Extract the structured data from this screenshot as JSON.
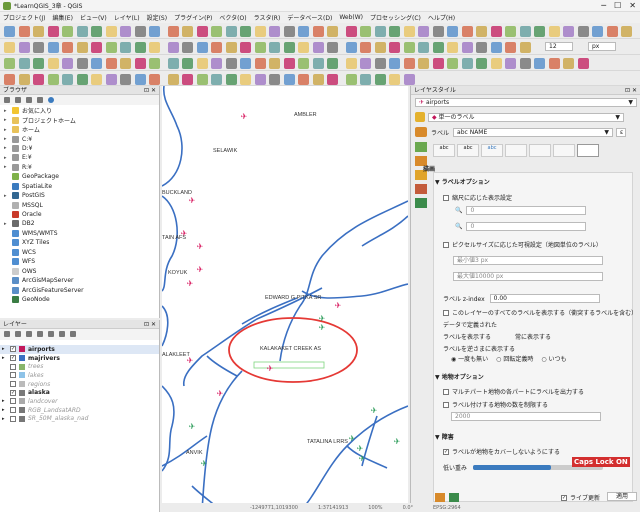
{
  "window": {
    "title": "*LearnQGIS_3章 - QGIS"
  },
  "menu": [
    "プロジェクト(J)",
    "編集(E)",
    "ビュー(V)",
    "レイヤ(L)",
    "設定(S)",
    "プラグイン(P)",
    "ベクタ(O)",
    "ラスタ(R)",
    "データベース(D)",
    "Web(W)",
    "プロセッシング(C)",
    "ヘルプ(H)"
  ],
  "toolbar": {
    "font_size": "12",
    "unit": "px",
    "text_label": "T"
  },
  "browser": {
    "title": "ブラウザ",
    "items": [
      {
        "label": "お気に入り",
        "icon": "star-icon",
        "color": "#f2c531"
      },
      {
        "label": "プロジェクトホーム",
        "icon": "folder-icon",
        "color": "#e8c25a"
      },
      {
        "label": "ホーム",
        "icon": "folder-icon",
        "color": "#e8c25a"
      },
      {
        "label": "C:¥",
        "icon": "drive-icon",
        "color": "#999999"
      },
      {
        "label": "D:¥",
        "icon": "drive-icon",
        "color": "#999999"
      },
      {
        "label": "E:¥",
        "icon": "drive-icon",
        "color": "#999999"
      },
      {
        "label": "R:¥",
        "icon": "drive-icon",
        "color": "#999999"
      },
      {
        "label": "GeoPackage",
        "icon": "geopackage-icon",
        "color": "#7fb24a"
      },
      {
        "label": "SpatiaLite",
        "icon": "spatialite-icon",
        "color": "#3b7bbf"
      },
      {
        "label": "PostGIS",
        "icon": "postgis-icon",
        "color": "#336791"
      },
      {
        "label": "MSSQL",
        "icon": "mssql-icon",
        "color": "#b0b0b0"
      },
      {
        "label": "Oracle",
        "icon": "oracle-icon",
        "color": "#c93b2b"
      },
      {
        "label": "DB2",
        "icon": "db2-icon",
        "color": "#6a6a6a"
      },
      {
        "label": "WMS/WMTS",
        "icon": "wms-icon",
        "color": "#4f8ed1"
      },
      {
        "label": "XYZ Tiles",
        "icon": "xyz-icon",
        "color": "#4f8ed1"
      },
      {
        "label": "WCS",
        "icon": "wcs-icon",
        "color": "#4f8ed1"
      },
      {
        "label": "WFS",
        "icon": "wfs-icon",
        "color": "#4f8ed1"
      },
      {
        "label": "OWS",
        "icon": "ows-icon",
        "color": "#cccccc"
      },
      {
        "label": "ArcGisMapServer",
        "icon": "arcgis-icon",
        "color": "#5b8fc7"
      },
      {
        "label": "ArcGisFeatureServer",
        "icon": "arcgis-icon",
        "color": "#5b8fc7"
      },
      {
        "label": "GeoNode",
        "icon": "geonode-icon",
        "color": "#3a7d44"
      }
    ]
  },
  "layers": {
    "title": "レイヤー",
    "items": [
      {
        "label": "airports",
        "checked": "✓",
        "bold": true,
        "color": "#c2185b"
      },
      {
        "label": "majrivers",
        "checked": "✓",
        "bold": true,
        "color": "#3a6fc2"
      },
      {
        "label": "trees",
        "checked": "",
        "bold": false,
        "color": "#88b56b"
      },
      {
        "label": "lakes",
        "checked": "",
        "bold": false,
        "color": "#8ec3e8"
      },
      {
        "label": "regions",
        "checked": "",
        "bold": false,
        "color": "#bbbbbb"
      },
      {
        "label": "alaska",
        "checked": "✓",
        "bold": true,
        "color": "#7a7a7a"
      },
      {
        "label": "landcover",
        "checked": "",
        "bold": false,
        "color": "#aaaaaa"
      },
      {
        "label": "RGB_LandsatARD",
        "checked": "",
        "bold": false,
        "color": "#777777"
      },
      {
        "label": "SR_50M_alaska_nad",
        "checked": "",
        "bold": false,
        "color": "#777777"
      }
    ]
  },
  "map_labels": [
    "AMBLER",
    "SELAWIK",
    "BUCKLAND",
    "TAIN AFS",
    "KOYUK",
    "EDWARD G PITKA SR",
    "KALAKAKET CREEK AS",
    "ALAKLEET",
    "TATALINA LRRS",
    "ANVIK"
  ],
  "styling": {
    "title": "レイヤスタイル",
    "layer": "airports",
    "mode": "単一のラベル",
    "label_field_label": "ラベル",
    "label_field_value": "abc NAME",
    "section": "描画",
    "label_options": "ラベルオプション",
    "scale_visibility": "縮尺に応じた表示設定",
    "scale_min": "0",
    "scale_max": "0",
    "pixel_size": "ピクセルサイズに応じた可視設定（地図単位のラベル）",
    "min_px": "最小値3 px",
    "max_px": "最大値10000 px",
    "zindex_label": "ラベル z-index",
    "zindex_value": "0.00",
    "show_all": "このレイヤーのすべてのラベルを表示する（衝突するラベルを含む）",
    "data_defined": "データで定義された",
    "show_labels": "ラベルを表示する",
    "always_show": "常に表示する",
    "upside_down": "ラベルを逆さまに表示する",
    "radio1": "一度も無い",
    "radio2": "回転定義時",
    "radio3": "いつも",
    "feature_options": "地物オプション",
    "multi_part": "マルチパート地物の各パートにラベルを出力する",
    "limit_count": "ラベル付けする地物の数を制限する",
    "limit_value": "2000",
    "obstacle_section": "障害",
    "obstacle": "ラベルが地物をカバーしないようにする",
    "weight": "低い重み",
    "live_update": "ライブ更新",
    "apply": "適用"
  },
  "status": {
    "coord": "-1249771,1019300",
    "scale": "1:37141913",
    "rotation": "0.0°",
    "magnifier": "100%",
    "crs": "EPSG:2964"
  },
  "caps_lock": "Caps Lock ON",
  "colors": {
    "airport": "#d81b60",
    "airport_green": "#2e9d5b",
    "river": "#3a6fc2",
    "highlight": "#e53935",
    "accent": "#d32f2f"
  }
}
